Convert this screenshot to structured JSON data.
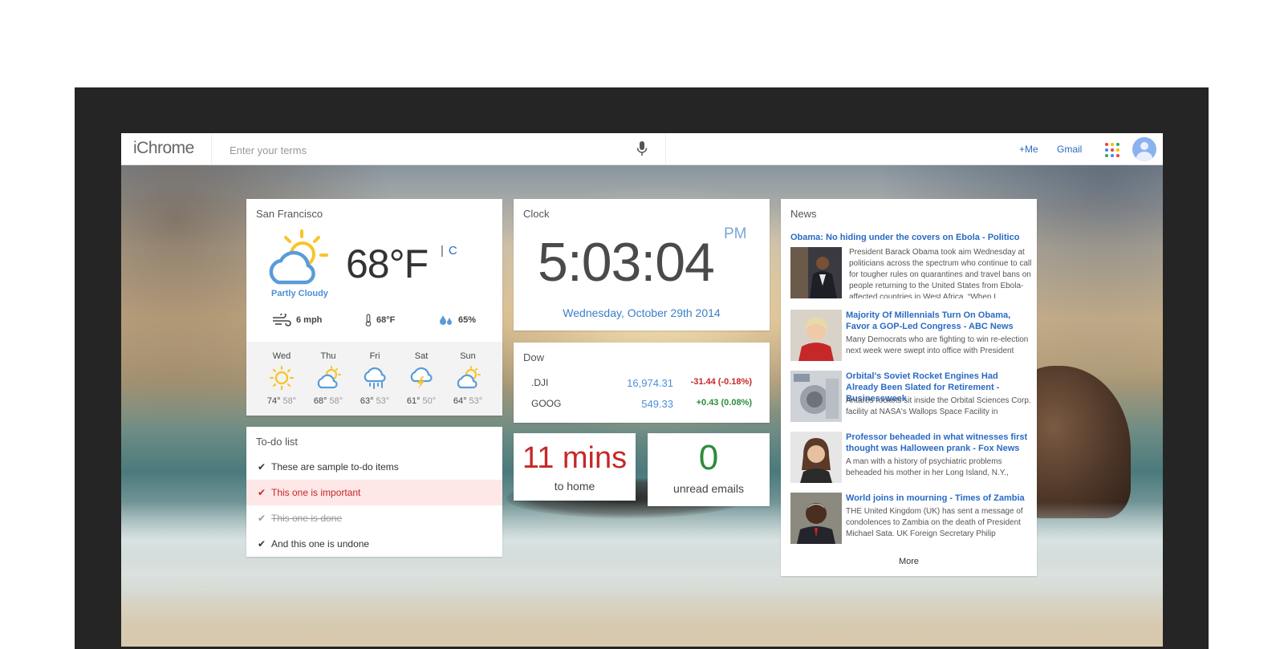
{
  "app": {
    "logo": "iChrome"
  },
  "search": {
    "placeholder": "Enter your terms"
  },
  "header": {
    "me_link": "+Me",
    "gmail_link": "Gmail"
  },
  "colors": {
    "accent": "#2a6ac4",
    "negative": "#c62828",
    "positive": "#2e8b3d"
  },
  "weather": {
    "title": "San Francisco",
    "temperature": "68°F",
    "unit_separator": "|",
    "alt_unit": "C",
    "condition": "Partly Cloudy",
    "condition_icon": "partly-cloudy-icon",
    "wind": "6 mph",
    "feels_like": "68°F",
    "humidity": "65%",
    "forecast": [
      {
        "day": "Wed",
        "high": "74°",
        "low": "58°",
        "icon": "sunny-icon"
      },
      {
        "day": "Thu",
        "high": "68°",
        "low": "58°",
        "icon": "partly-cloudy-icon"
      },
      {
        "day": "Fri",
        "high": "63°",
        "low": "53°",
        "icon": "rain-icon"
      },
      {
        "day": "Sat",
        "high": "61°",
        "low": "50°",
        "icon": "thunderstorm-icon"
      },
      {
        "day": "Sun",
        "high": "64°",
        "low": "53°",
        "icon": "partly-cloudy-icon"
      }
    ]
  },
  "todo": {
    "title": "To-do list",
    "items": [
      {
        "text": "These are sample to-do items",
        "state": "normal"
      },
      {
        "text": "This one is important",
        "state": "important"
      },
      {
        "text": "This one is done",
        "state": "done"
      },
      {
        "text": "And this one is undone",
        "state": "normal"
      }
    ]
  },
  "clock": {
    "title": "Clock",
    "time": "5:03:04",
    "ampm": "PM",
    "date": "Wednesday, October 29th 2014"
  },
  "dow": {
    "title": "Dow",
    "stocks": [
      {
        "symbol": ".DJI",
        "value": "16,974.31",
        "change": "-31.44 (-0.18%)"
      },
      {
        "symbol": "GOOG",
        "value": "549.33",
        "change": "+0.43 (0.08%)"
      }
    ]
  },
  "commute": {
    "value": "11 mins",
    "label": "to home"
  },
  "emails": {
    "count": "0",
    "label": "unread emails"
  },
  "news": {
    "title": "News",
    "more": "More",
    "items": [
      {
        "title": "Obama: No hiding under the covers on Ebola - Politico",
        "text": "President Barack Obama took aim Wednesday at politicians across the spectrum who continue to call for tougher rules on quarantines and travel bans on people returning to the United States from Ebola-affected countries in West Africa. “When I"
      },
      {
        "title": "Majority Of Millennials Turn On Obama, Favor a GOP-Led Congress - ABC News",
        "text": "Many Democrats who are fighting to win re-election next week were swept into office with President"
      },
      {
        "title": "Orbital's Soviet Rocket Engines Had Already Been Slated for Retirement - Businessweek",
        "text": "Antares rockets sit inside the Orbital Sciences Corp. facility at NASA's Wallops Space Facility in"
      },
      {
        "title": "Professor beheaded in what witnesses first thought was Halloween prank - Fox News",
        "text": "A man with a history of psychiatric problems beheaded his mother in her Long Island, N.Y.,"
      },
      {
        "title": "World joins in mourning - Times of Zambia",
        "text": "THE United Kingdom (UK) has sent a message of condolences to Zambia on the death of President Michael Sata. UK Foreign Secretary Philip"
      }
    ]
  }
}
